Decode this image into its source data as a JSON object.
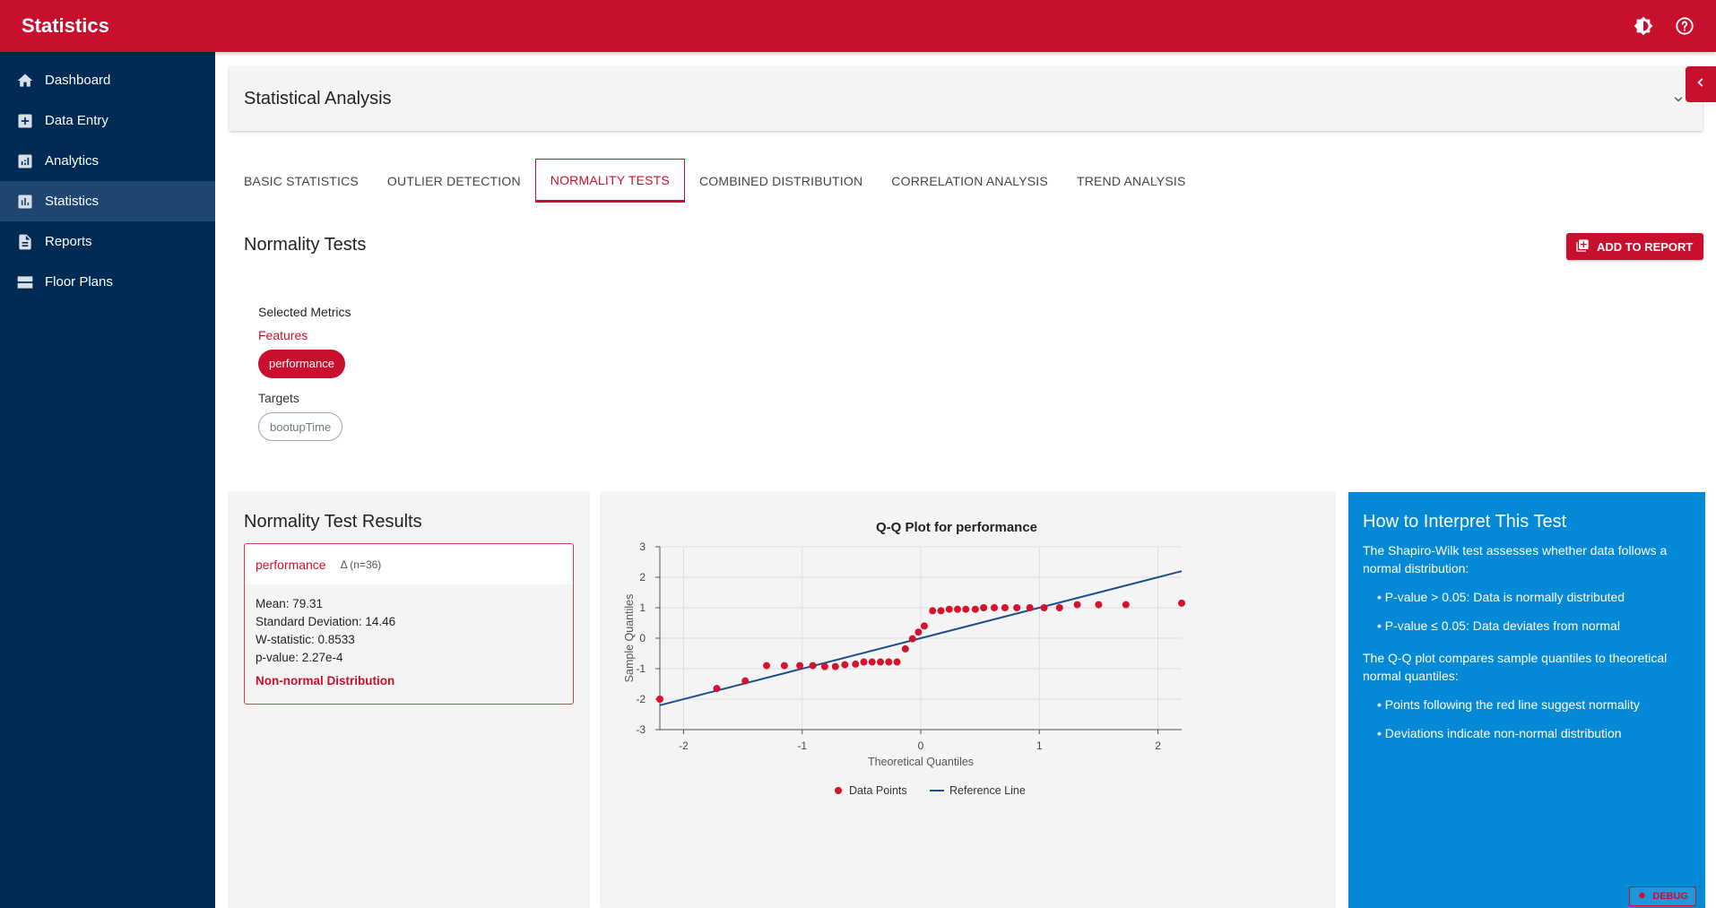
{
  "app": {
    "title": "Statistics"
  },
  "header": {
    "icons": [
      "brightness-icon",
      "help-icon"
    ]
  },
  "sidebar": {
    "items": [
      {
        "label": "Dashboard",
        "icon": "home-icon",
        "active": false
      },
      {
        "label": "Data Entry",
        "icon": "add-box-icon",
        "active": false
      },
      {
        "label": "Analytics",
        "icon": "analytics-icon",
        "active": false
      },
      {
        "label": "Statistics",
        "icon": "bar-chart-icon",
        "active": true
      },
      {
        "label": "Reports",
        "icon": "description-icon",
        "active": false
      },
      {
        "label": "Floor Plans",
        "icon": "floor-plan-icon",
        "active": false
      }
    ]
  },
  "accordion": {
    "title": "Statistical Analysis"
  },
  "tabs": [
    {
      "label": "BASIC STATISTICS",
      "active": false
    },
    {
      "label": "OUTLIER DETECTION",
      "active": false
    },
    {
      "label": "NORMALITY TESTS",
      "active": true
    },
    {
      "label": "COMBINED DISTRIBUTION",
      "active": false
    },
    {
      "label": "CORRELATION ANALYSIS",
      "active": false
    },
    {
      "label": "TREND ANALYSIS",
      "active": false
    }
  ],
  "section": {
    "title": "Normality Tests",
    "add_to_report": "ADD TO REPORT"
  },
  "metrics": {
    "title": "Selected Metrics",
    "features_label": "Features",
    "features": [
      "performance"
    ],
    "targets_label": "Targets",
    "targets": [
      "bootupTime"
    ]
  },
  "results": {
    "title": "Normality Test Results",
    "metric": "performance",
    "n_label": "Δ (n=36)",
    "mean": "Mean: 79.31",
    "std": "Standard Deviation: 14.46",
    "w_stat": "W-statistic: 0.8533",
    "p_value": "p-value: 2.27e-4",
    "verdict": "Non-normal Distribution"
  },
  "colors": {
    "brand_red": "#c8102e",
    "sidebar_navy": "#002b55",
    "info_blue": "#0389d6",
    "reference_line": "#1f4e8c"
  },
  "chart_data": {
    "type": "scatter",
    "title": "Q-Q Plot for performance",
    "xlabel": "Theoretical Quantiles",
    "ylabel": "Sample Quantiles",
    "xlim": [
      -2.2,
      2.2
    ],
    "ylim": [
      -3,
      3
    ],
    "x_ticks": [
      "-2",
      "-1",
      "0",
      "1",
      "2"
    ],
    "y_ticks": [
      "3",
      "2",
      "1",
      "0",
      "-1",
      "-2",
      "-3"
    ],
    "grid": true,
    "legend": "bottom-center",
    "series": [
      {
        "name": "Data Points",
        "kind": "points",
        "color": "#d3122d",
        "x": [
          -2.2,
          -1.72,
          -1.48,
          -1.3,
          -1.15,
          -1.02,
          -0.91,
          -0.81,
          -0.72,
          -0.64,
          -0.55,
          -0.48,
          -0.41,
          -0.34,
          -0.27,
          -0.2,
          -0.13,
          -0.07,
          -0.02,
          0.03,
          0.1,
          0.17,
          0.24,
          0.31,
          0.38,
          0.46,
          0.53,
          0.62,
          0.71,
          0.81,
          0.92,
          1.04,
          1.17,
          1.32,
          1.5,
          1.73,
          2.2
        ],
        "y": [
          -2.0,
          -1.65,
          -1.4,
          -0.9,
          -0.9,
          -0.9,
          -0.9,
          -0.93,
          -0.93,
          -0.87,
          -0.85,
          -0.78,
          -0.78,
          -0.78,
          -0.78,
          -0.78,
          -0.35,
          -0.02,
          0.2,
          0.4,
          0.9,
          0.9,
          0.95,
          0.95,
          0.95,
          0.95,
          1.0,
          1.0,
          1.0,
          1.0,
          1.0,
          1.0,
          1.0,
          1.1,
          1.1,
          1.1,
          1.15
        ]
      },
      {
        "name": "Reference Line",
        "kind": "line",
        "color": "#1f4e8c",
        "x": [
          -2.2,
          2.2
        ],
        "y": [
          -2.2,
          2.2
        ]
      }
    ]
  },
  "info": {
    "title": "How to Interpret This Test",
    "intro": "The Shapiro-Wilk test assesses whether data follows a normal distribution:",
    "bullets_1": [
      "• P-value > 0.05: Data is normally distributed",
      "• P-value ≤ 0.05: Data deviates from normal"
    ],
    "qq_intro": "The Q-Q plot compares sample quantiles to theoretical normal quantiles:",
    "bullets_2": [
      "• Points following the red line suggest normality",
      "• Deviations indicate non-normal distribution"
    ]
  },
  "debug": {
    "label": "DEBUG"
  }
}
